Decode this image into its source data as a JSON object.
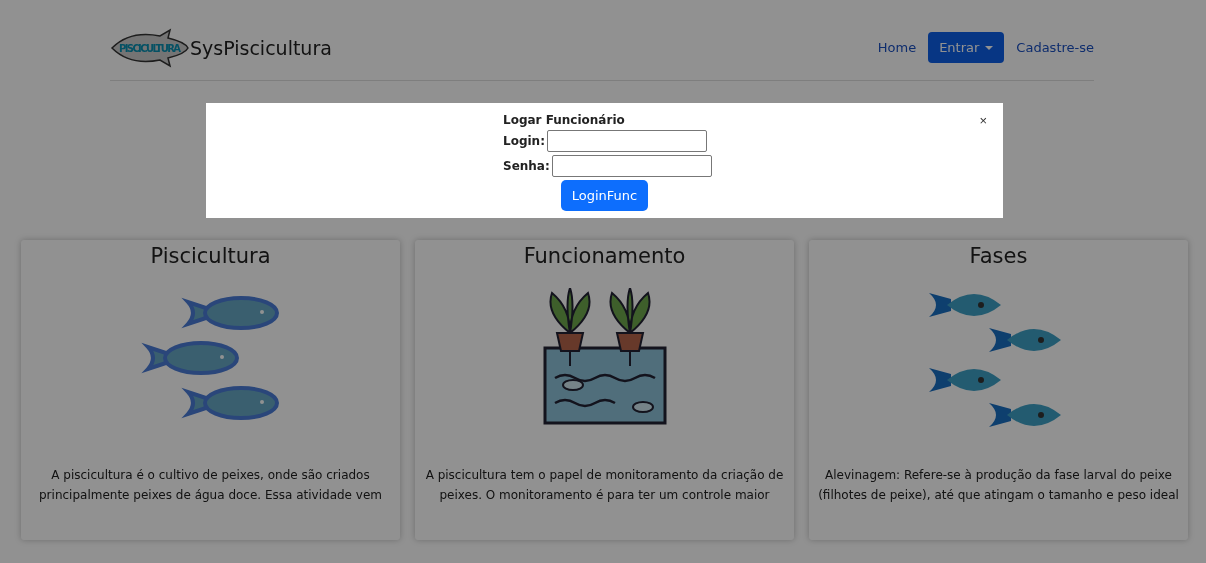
{
  "navbar": {
    "logo_text": "PISCICULTURA",
    "brand": "SysPiscicultura",
    "items": [
      {
        "kind": "link",
        "label": "Home"
      },
      {
        "kind": "dropdown",
        "label": "Entrar"
      },
      {
        "kind": "link",
        "label": "Cadastre-se"
      }
    ]
  },
  "cards": [
    {
      "kind": "fish-school",
      "title": "Piscicultura",
      "lines": [
        "A piscicultura é o cultivo de peixes, onde são criados",
        "principalmente peixes de água doce. Essa atividade vem"
      ]
    },
    {
      "kind": "aquaponics",
      "title": "Funcionamento",
      "lines": [
        "A piscicultura tem o papel de monitoramento da criação de",
        "peixes. O monitoramento é para ter um controle maior"
      ]
    },
    {
      "kind": "fish-phases",
      "title": "Fases",
      "lines": [
        "Alevinagem: Refere-se à produção da fase larval do peixe",
        "(filhotes de peixe), até que atingam o tamanho e peso ideal"
      ]
    }
  ],
  "modal": {
    "title": "Logar Funcionário",
    "fields": [
      {
        "label": "Login:"
      },
      {
        "label": "Senha:"
      }
    ],
    "button": "LoginFunc",
    "close": "×"
  }
}
